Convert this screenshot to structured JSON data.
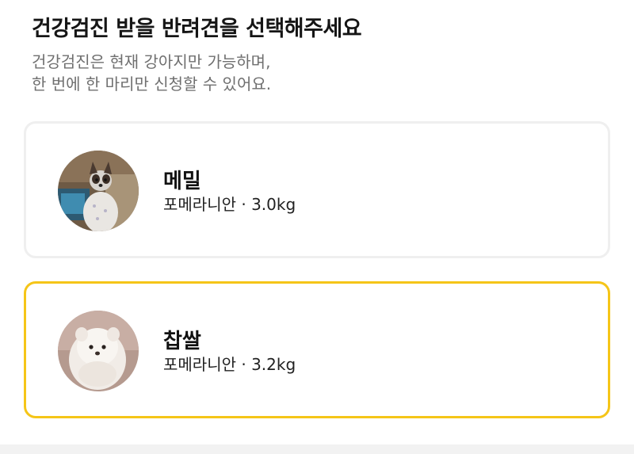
{
  "header": {
    "title": "건강검진 받을 반려견을 선택해주세요",
    "subtitle_line1": "건강검진은 현재 강아지만 가능하며,",
    "subtitle_line2": "한 번에 한 마리만 신청할 수 있어요."
  },
  "pets": [
    {
      "name": "메밀",
      "info": "포메라니안 · 3.0kg",
      "selected": false
    },
    {
      "name": "찹쌀",
      "info": "포메라니안 · 3.2kg",
      "selected": true
    }
  ],
  "colors": {
    "selected_border": "#f5c518",
    "card_border": "#efefef",
    "subtitle_text": "#6f6f6f"
  }
}
